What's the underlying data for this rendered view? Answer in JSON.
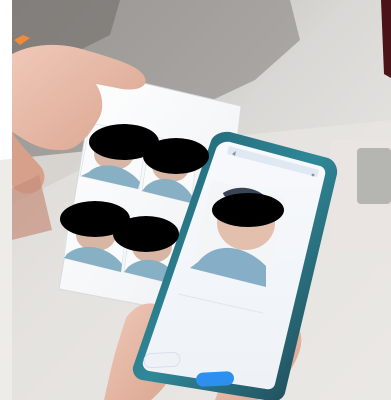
{
  "scene": {
    "description_free": true,
    "background_color": "#e9e8e4",
    "table_color": "#cfd0cd",
    "paper_color": "#f6f6f7",
    "phone_body_color": "#2c7a8a",
    "phone_screen_color": "#f2f4f7",
    "accent_color": "#2d8ff0",
    "redaction_color": "#000000"
  },
  "photo_sheet": {
    "layout": "2x2",
    "redacted_faces": 4
  },
  "phone": {
    "header_title": "",
    "status_text": "",
    "form_rows": [
      "",
      "",
      "",
      ""
    ],
    "tabs": [
      "",
      "",
      ""
    ],
    "primary_button_label": "",
    "secondary_button_label": ""
  },
  "icons": {
    "back": "chevron-left-icon",
    "more": "more-icon"
  }
}
